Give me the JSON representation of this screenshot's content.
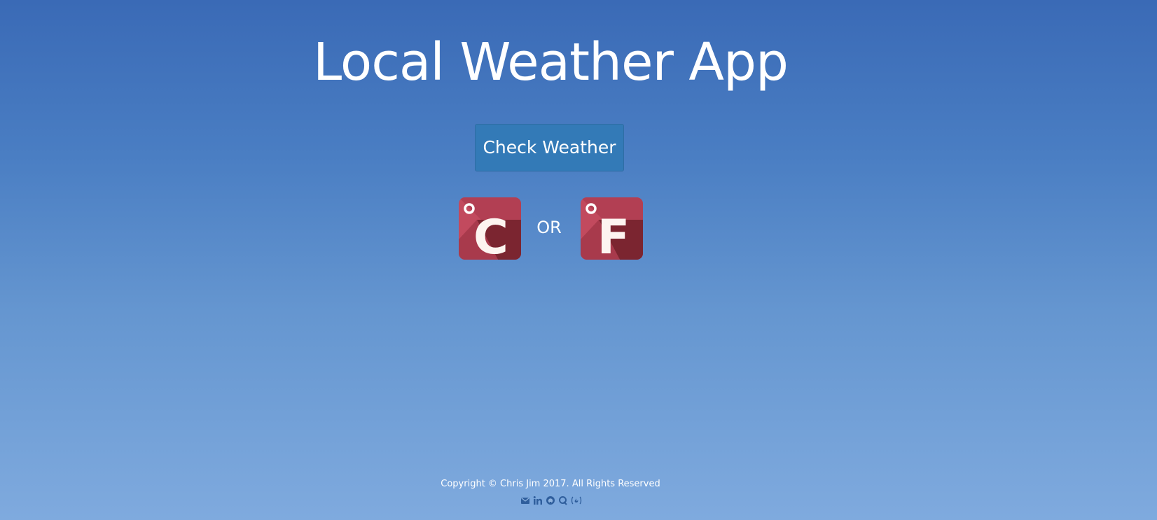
{
  "header": {
    "title": "Local Weather App"
  },
  "actions": {
    "check_weather_label": "Check Weather"
  },
  "units": {
    "celsius_symbol": "C",
    "fahrenheit_symbol": "F",
    "separator": "OR"
  },
  "footer": {
    "copyright": "Copyright © Chris Jim 2017. All Rights Reserved",
    "social_icons": [
      "envelope-icon",
      "linkedin-icon",
      "github-icon",
      "quora-icon",
      "freecodecamp-icon"
    ]
  },
  "colors": {
    "background_top": "#3a6ab6",
    "background_bottom": "#7faade",
    "button": "#337ab7",
    "tile_light": "#c24a5e",
    "tile_dark": "#7b2530",
    "icon_link": "#2f5e9c"
  }
}
